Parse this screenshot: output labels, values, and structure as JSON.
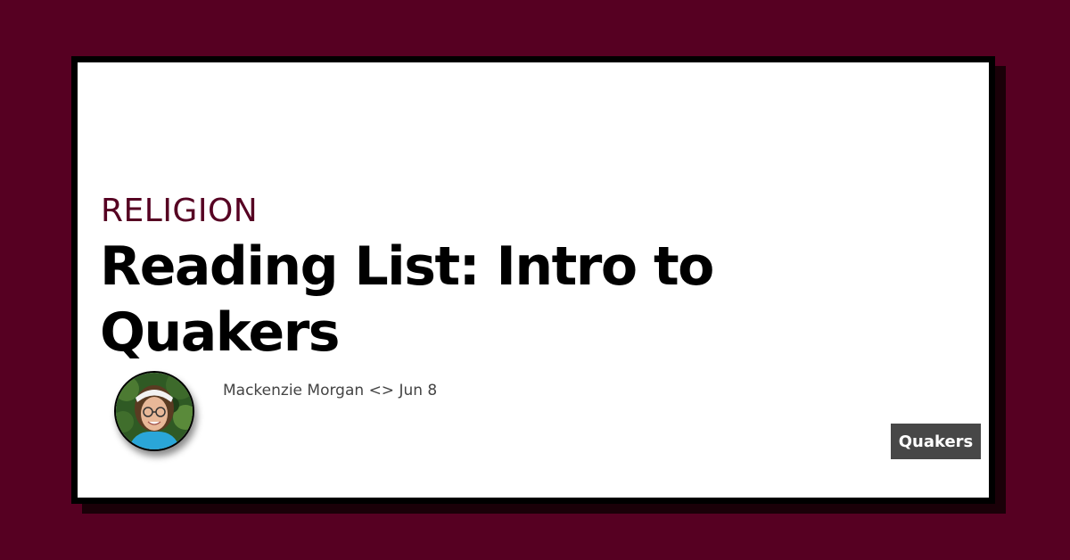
{
  "post": {
    "category": "RELIGION",
    "title": "Reading List: Intro to Quakers",
    "author": "Mackenzie Morgan",
    "separator": "<>",
    "date": "Jun 8",
    "tag": "Quakers"
  },
  "colors": {
    "background": "#560022",
    "accent": "#560022",
    "card": "#ffffff",
    "tag_background": "#474747"
  },
  "icons": {
    "avatar": "author-photo"
  }
}
